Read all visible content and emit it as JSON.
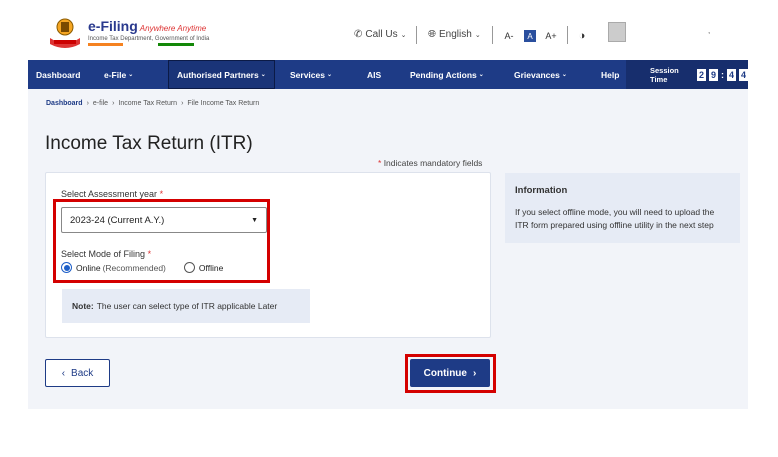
{
  "header": {
    "logo_title": "e-Filing",
    "logo_tagline": "Anywhere Anytime",
    "logo_subtitle": "Income Tax Department, Government of India",
    "call_us": "Call Us",
    "language": "English",
    "font_decrease": "A-",
    "font_normal": "A",
    "font_increase": "A+",
    "contrast_icon": "half-circle-icon",
    "mark": ","
  },
  "nav": {
    "items": [
      {
        "label": "Dashboard"
      },
      {
        "label": "e-File"
      },
      {
        "label": "Authorised Partners"
      },
      {
        "label": "Services"
      },
      {
        "label": "AIS"
      },
      {
        "label": "Pending Actions"
      },
      {
        "label": "Grievances"
      },
      {
        "label": "Help"
      }
    ],
    "session_label": "Session Time",
    "session_digits": [
      "2",
      "9",
      "4",
      "4"
    ]
  },
  "breadcrumb": [
    "Dashboard",
    "e-file",
    "Income Tax Return",
    "File Income Tax Return"
  ],
  "page": {
    "title": "Income Tax Return (ITR)",
    "mandatory_star": "*",
    "mandatory_note": "Indicates mandatory fields"
  },
  "form": {
    "assessment_label": "Select Assessment year",
    "assessment_value": "2023-24 (Current A.Y.)",
    "mode_label": "Select Mode of Filing",
    "mode_online": "Online",
    "mode_online_sub": "(Recommended)",
    "mode_offline": "Offline",
    "selected_mode": "online"
  },
  "note": {
    "label": "Note:",
    "text": "The user can select type of ITR applicable Later"
  },
  "info": {
    "title": "Information",
    "text": "If you select offline mode, you will need to upload the ITR form prepared using offline utility in the next step"
  },
  "actions": {
    "back": "Back",
    "continue": "Continue"
  },
  "colors": {
    "nav_bg": "#1e3b86",
    "highlight": "#d40000",
    "panel_bg": "#f2f4f9"
  }
}
